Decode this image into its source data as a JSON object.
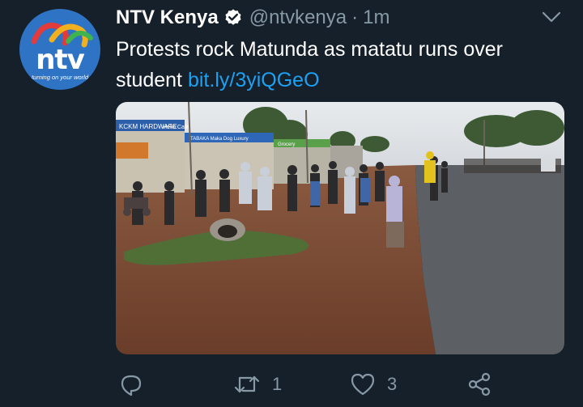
{
  "account": {
    "display_name": "NTV Kenya",
    "handle": "@ntvkenya",
    "separator": "·",
    "time_ago": "1m",
    "avatar_logo": "ntv",
    "avatar_tagline": "turning on your world"
  },
  "tweet": {
    "text": "Protests rock Matunda as matatu runs over student",
    "link": "bit.ly/3yiQGeO"
  },
  "media": {
    "shop_sign_left": "KCKM HARDWARE",
    "shop_sign_2": "Hello Cafe",
    "shop_sign_3": "TABAKA Maka Dog Luxury",
    "shop_sign_4": "Grocery"
  },
  "actions": {
    "reply_count": "",
    "retweet_count": "1",
    "like_count": "3"
  },
  "colors": {
    "background": "#15202b",
    "muted": "#8899a6",
    "link": "#1da1f2",
    "verified": "#ffffff"
  },
  "icons": [
    "verified-badge-icon",
    "chevron-down-icon",
    "reply-icon",
    "retweet-icon",
    "like-icon",
    "share-icon"
  ]
}
